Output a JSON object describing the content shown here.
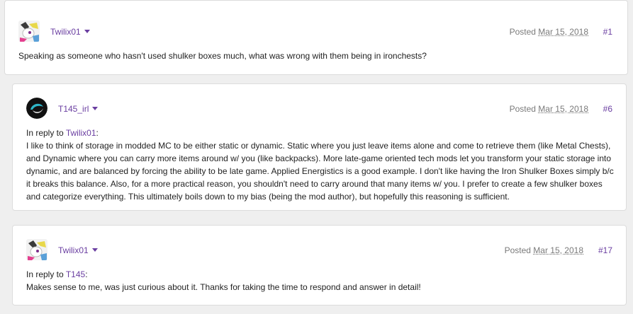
{
  "posts": [
    {
      "username": "Twilix01",
      "posted_label": "Posted",
      "date": "Mar 15, 2018",
      "number": "#1",
      "text": "Speaking as someone who hasn't used shulker boxes much, what was wrong with them being in ironchests?"
    },
    {
      "username": "T145_irl",
      "posted_label": "Posted",
      "date": "Mar 15, 2018",
      "number": "#6",
      "reply_prefix": "In reply to",
      "reply_to": "Twilix01",
      "reply_suffix": ":",
      "text": " I like to think of storage in modded MC to be either static or dynamic. Static where you just leave items alone and come to retrieve them (like Metal Chests), and Dynamic where you can carry more items around w/ you (like backpacks). More late-game oriented tech mods let you transform your static storage into dynamic, and are balanced by forcing the ability to be late game. Applied Energistics is a good example. I don't like having the Iron Shulker Boxes simply b/c it breaks this balance. Also, for a more practical reason, you shouldn't need to carry around that many items w/ you. I prefer to create a few shulker boxes and categorize everything. This ultimately boils down to my bias (being the mod author), but hopefully this reasoning is sufficient."
    },
    {
      "username": "Twilix01",
      "posted_label": "Posted",
      "date": "Mar 15, 2018",
      "number": "#17",
      "reply_prefix": "In reply to",
      "reply_to": "T145",
      "reply_suffix": ":",
      "text": " Makes sense to me, was just curious about it. Thanks for taking the time to respond and answer in detail!"
    }
  ],
  "icons": {
    "dropdown": "chevron-down-icon",
    "avatar_twilix": "pony-avatar",
    "avatar_t145": "swirl-avatar"
  },
  "colors": {
    "accent": "#6a3ea1",
    "page_bg": "#efefef",
    "card_bg": "#ffffff"
  }
}
